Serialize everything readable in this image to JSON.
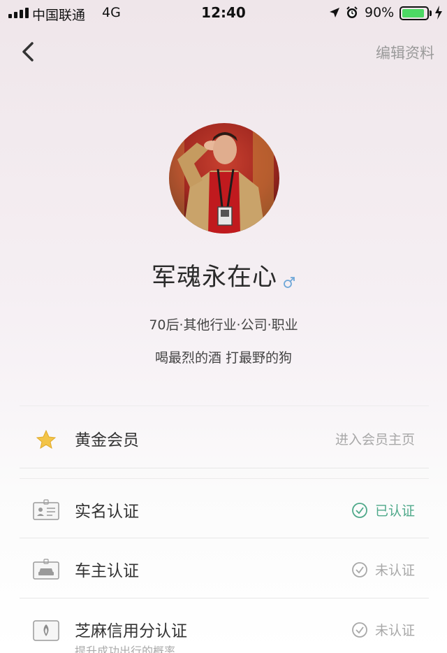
{
  "status_bar": {
    "carrier": "中国联通",
    "network": "4G",
    "time": "12:40",
    "battery_percent": "90%",
    "battery_level": 0.9,
    "battery_color": "#4cd964"
  },
  "nav": {
    "back_icon": "chevron-left-icon",
    "edit_label": "编辑资料"
  },
  "profile": {
    "username": "军魂永在心",
    "gender_icon": "male-icon",
    "tagline": "70后·其他行业·公司·职业",
    "motto": "喝最烈的酒 打最野的狗"
  },
  "list": {
    "membership": {
      "icon": "star-icon",
      "label": "黄金会员",
      "action": "进入会员主页"
    },
    "real_name": {
      "icon": "id-card-icon",
      "label": "实名认证",
      "status": "已认证",
      "status_icon": "check-circle-icon",
      "status_color": "#4fa98a"
    },
    "car_owner": {
      "icon": "car-card-icon",
      "label": "车主认证",
      "status": "未认证",
      "status_icon": "check-circle-icon"
    },
    "sesame_credit": {
      "icon": "sesame-icon",
      "label": "芝麻信用分认证",
      "sublabel": "提升成功出行的概率",
      "status": "未认证",
      "status_icon": "check-circle-icon"
    }
  }
}
